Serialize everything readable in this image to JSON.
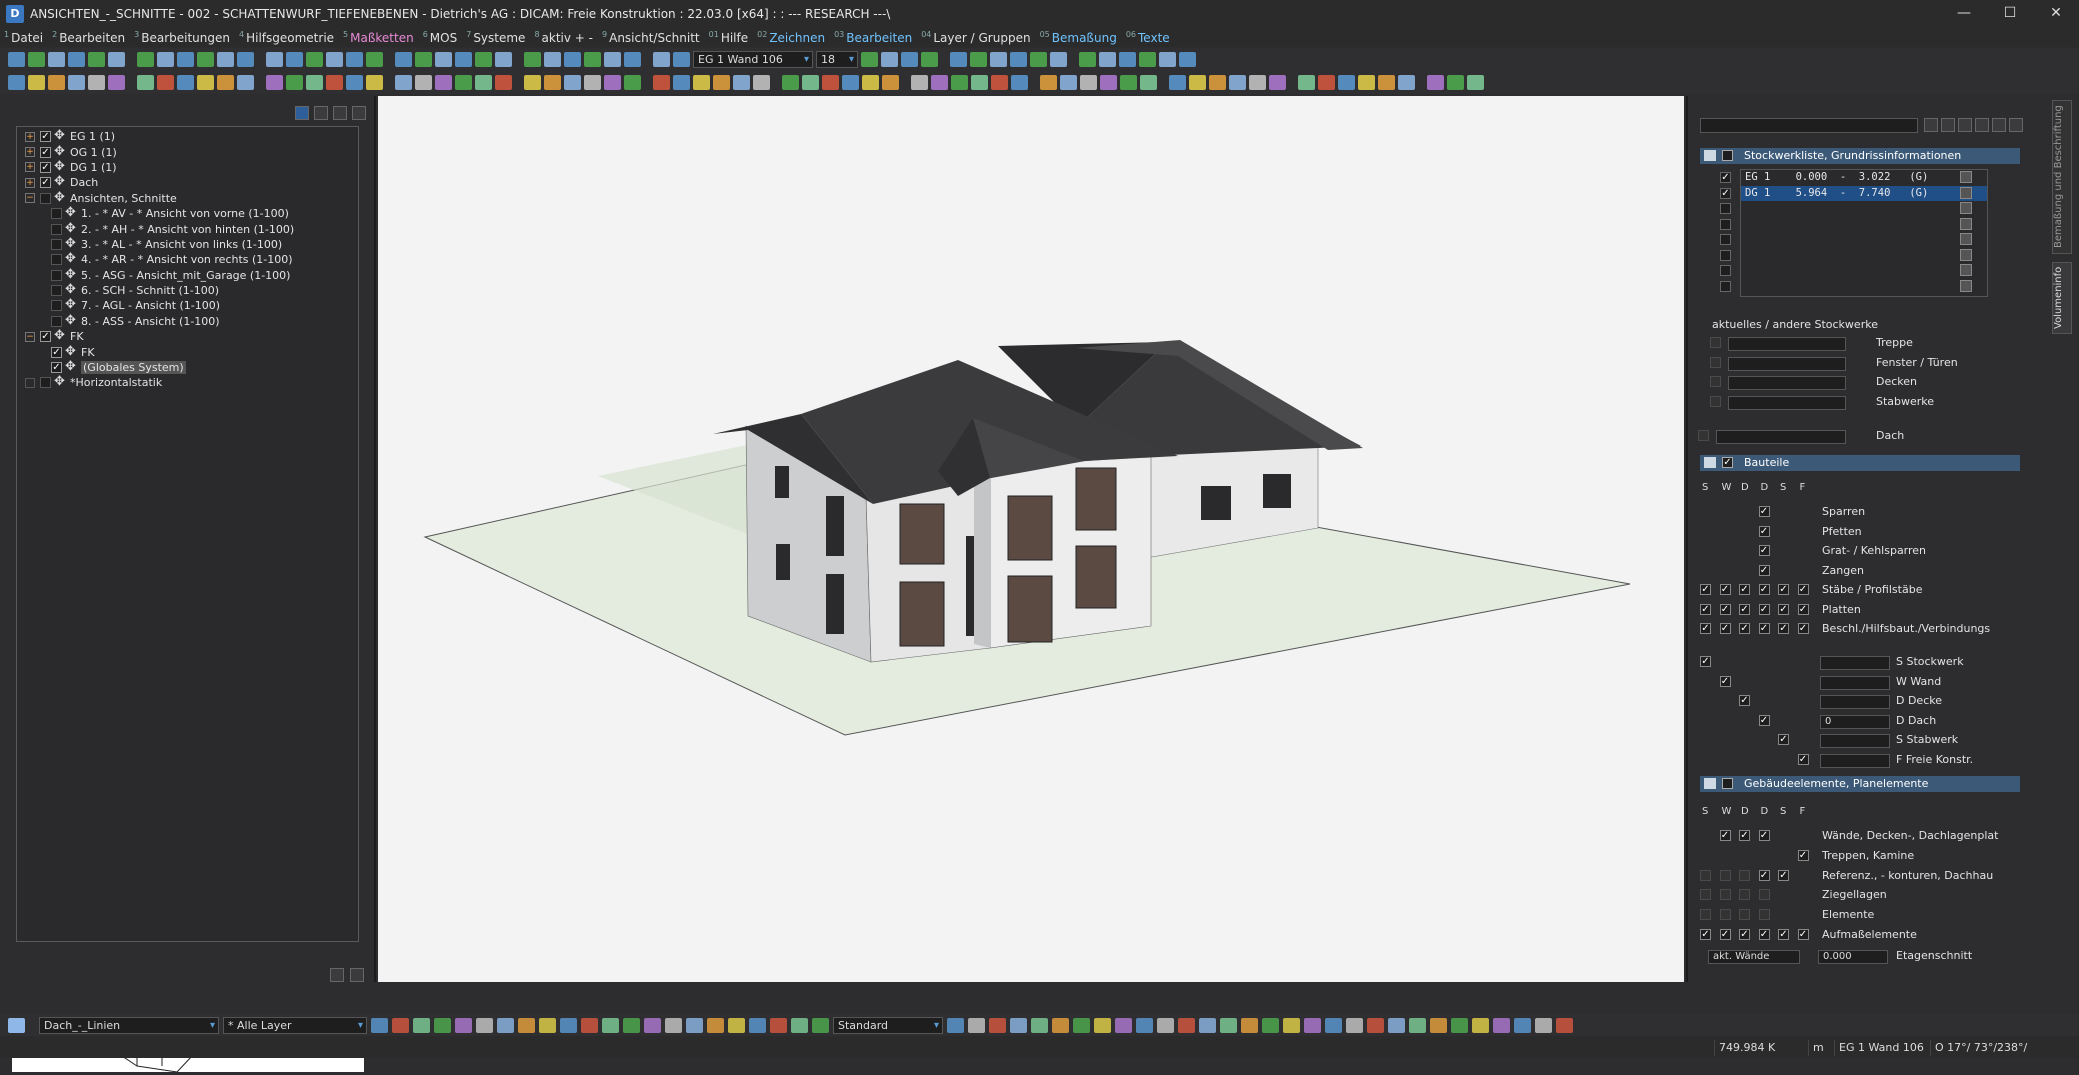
{
  "window": {
    "title": "ANSICHTEN_-_SCHNITTE - 002 - SCHATTENWURF_TIEFENEBENEN - Dietrich's AG : DICAM: Freie Konstruktion : 22.03.0 [x64] : : --- RESEARCH ---\\",
    "app_icon": "D",
    "minimize": "—",
    "maximize": "☐",
    "close": "✕"
  },
  "menu": [
    {
      "num": "1",
      "label": "Datei",
      "color": "#e0e0e0"
    },
    {
      "num": "2",
      "label": "Bearbeiten",
      "color": "#e0e0e0"
    },
    {
      "num": "3",
      "label": "Bearbeitungen",
      "color": "#e0e0e0"
    },
    {
      "num": "4",
      "label": "Hilfsgeometrie",
      "color": "#e0e0e0"
    },
    {
      "num": "5",
      "label": "Maßketten",
      "color": "#e88ad6"
    },
    {
      "num": "6",
      "label": "MOS",
      "color": "#e0e0e0"
    },
    {
      "num": "7",
      "label": "Systeme",
      "color": "#e0e0e0"
    },
    {
      "num": "8",
      "label": "aktiv + -",
      "color": "#e0e0e0"
    },
    {
      "num": "9",
      "label": "Ansicht/Schnitt",
      "color": "#e0e0e0"
    },
    {
      "num": "01",
      "label": "Hilfe",
      "color": "#e0e0e0"
    },
    {
      "num": "02",
      "label": "Zeichnen",
      "color": "#6fc3ff"
    },
    {
      "num": "03",
      "label": "Bearbeiten",
      "color": "#6fc3ff"
    },
    {
      "num": "04",
      "label": "Layer / Gruppen",
      "color": "#e0e0e0"
    },
    {
      "num": "05",
      "label": "Bemaßung",
      "color": "#6fc3ff"
    },
    {
      "num": "06",
      "label": "Texte",
      "color": "#6fc3ff"
    }
  ],
  "toolbar1": {
    "wall_combo": "EG 1 Wand 106",
    "size_combo": "18"
  },
  "tree": [
    {
      "indent": 0,
      "exp": "+",
      "checked": true,
      "label": "EG 1 (1)"
    },
    {
      "indent": 0,
      "exp": "+",
      "checked": true,
      "label": "OG 1 (1)"
    },
    {
      "indent": 0,
      "exp": "+",
      "checked": true,
      "label": "DG 1 (1)"
    },
    {
      "indent": 0,
      "exp": "+",
      "checked": true,
      "label": "Dach"
    },
    {
      "indent": 0,
      "exp": "−",
      "checked": false,
      "label": "Ansichten, Schnitte"
    },
    {
      "indent": 1,
      "exp": "",
      "checked": false,
      "label": "1. - * AV - * Ansicht von vorne (1-100)"
    },
    {
      "indent": 1,
      "exp": "",
      "checked": false,
      "label": "2. - * AH - * Ansicht von hinten (1-100)"
    },
    {
      "indent": 1,
      "exp": "",
      "checked": false,
      "label": "3. - * AL - * Ansicht von links (1-100)"
    },
    {
      "indent": 1,
      "exp": "",
      "checked": false,
      "label": "4. - * AR - * Ansicht von rechts (1-100)"
    },
    {
      "indent": 1,
      "exp": "",
      "checked": false,
      "label": "5. - ASG - Ansicht_mit_Garage (1-100)"
    },
    {
      "indent": 1,
      "exp": "",
      "checked": false,
      "label": "6. - SCH - Schnitt (1-100)"
    },
    {
      "indent": 1,
      "exp": "",
      "checked": false,
      "label": "7. - AGL - Ansicht (1-100)"
    },
    {
      "indent": 1,
      "exp": "",
      "checked": false,
      "label": "8. - ASS - Ansicht (1-100)"
    },
    {
      "indent": 0,
      "exp": "−",
      "checked": true,
      "label": "FK"
    },
    {
      "indent": 1,
      "exp": "",
      "checked": true,
      "label": "FK"
    },
    {
      "indent": 1,
      "exp": "",
      "checked": true,
      "label": "(Globales System)",
      "selected": true
    },
    {
      "indent": 0,
      "exp": "",
      "checked": false,
      "label": "*Horizontalstatik"
    }
  ],
  "right": {
    "section1": "Stockwerkliste, Grundrissinformationen",
    "floors": [
      {
        "text": "EG 1    0.000  -  3.022   (G)",
        "checked": true,
        "selected": false
      },
      {
        "text": "DG 1    5.964  -  7.740   (G)",
        "checked": true,
        "selected": true
      },
      {
        "text": "",
        "checked": false,
        "selected": false
      },
      {
        "text": "",
        "checked": false,
        "selected": false
      },
      {
        "text": "",
        "checked": false,
        "selected": false
      },
      {
        "text": "",
        "checked": false,
        "selected": false
      },
      {
        "text": "",
        "checked": false,
        "selected": false
      },
      {
        "text": "",
        "checked": false,
        "selected": false
      }
    ],
    "current_label": "aktuelles / andere Stockwerke",
    "current_items": [
      "Treppe",
      "Fenster / Türen",
      "Decken",
      "Stabwerke"
    ],
    "dach_label": "Dach",
    "section2": "Bauteile",
    "col_headers": [
      "S",
      "W",
      "D",
      "D",
      "S",
      "F"
    ],
    "bauteile": [
      {
        "label": "Sparren",
        "checks": [
          0,
          0,
          0,
          1,
          0,
          0
        ]
      },
      {
        "label": "Pfetten",
        "checks": [
          0,
          0,
          0,
          1,
          0,
          0
        ]
      },
      {
        "label": "Grat- / Kehlsparren",
        "checks": [
          0,
          0,
          0,
          1,
          0,
          0
        ]
      },
      {
        "label": "Zangen",
        "checks": [
          0,
          0,
          0,
          1,
          0,
          0
        ]
      },
      {
        "label": "Stäbe / Profilstäbe",
        "checks": [
          1,
          1,
          1,
          1,
          1,
          1
        ]
      },
      {
        "label": "Platten",
        "checks": [
          1,
          1,
          1,
          1,
          1,
          1
        ]
      },
      {
        "label": "Beschl./Hilfsbaut./Verbindungs",
        "checks": [
          1,
          1,
          1,
          1,
          1,
          1
        ]
      }
    ],
    "filters": [
      {
        "label": "S Stockwerk",
        "value": ""
      },
      {
        "label": "W Wand",
        "value": ""
      },
      {
        "label": "D Decke",
        "value": ""
      },
      {
        "label": "D Dach",
        "value": "0"
      },
      {
        "label": "S Stabwerk",
        "value": ""
      },
      {
        "label": "F Freie Konstr.",
        "value": ""
      }
    ],
    "section3": "Gebäudeelemente, Planelemente",
    "gebaeude": [
      {
        "label": "Wände, Decken-, Dachlagenplat",
        "checks": [
          0,
          1,
          1,
          1,
          0,
          0
        ]
      },
      {
        "label": "Treppen, Kamine",
        "checks": [
          0,
          0,
          0,
          0,
          0,
          1
        ]
      },
      {
        "label": "Referenz., - konturen, Dachhau",
        "checks": [
          0,
          0,
          0,
          1,
          1,
          0
        ]
      },
      {
        "label": "Ziegellagen",
        "checks": [
          0,
          0,
          0,
          0,
          0,
          0
        ]
      },
      {
        "label": "Elemente",
        "checks": [
          0,
          0,
          0,
          0,
          0,
          0
        ]
      },
      {
        "label": "Aufmaßelemente",
        "checks": [
          1,
          1,
          1,
          1,
          1,
          1
        ]
      }
    ],
    "etagen_combo": "akt. Wände",
    "etagen_value": "0.000",
    "etagen_label": "Etagenschnitt"
  },
  "vtabs": [
    "Bemaßung und Beschriftung",
    "Volumeninfo"
  ],
  "bottom": {
    "layer_combo": "Dach_-_Linien",
    "filter_combo": "* Alle Layer",
    "style_combo": "Standard"
  },
  "status": {
    "coord": "749.984 K",
    "unit": "m",
    "element": "EG 1 Wand 106",
    "angles": "O 17°/ 73°/238°/"
  },
  "colors": {
    "accent": "#3c5a78",
    "selection": "#1f4f86",
    "roof": "#3a3a3c",
    "wall": "#e9e9ea",
    "ground": "#e3ecdf"
  }
}
